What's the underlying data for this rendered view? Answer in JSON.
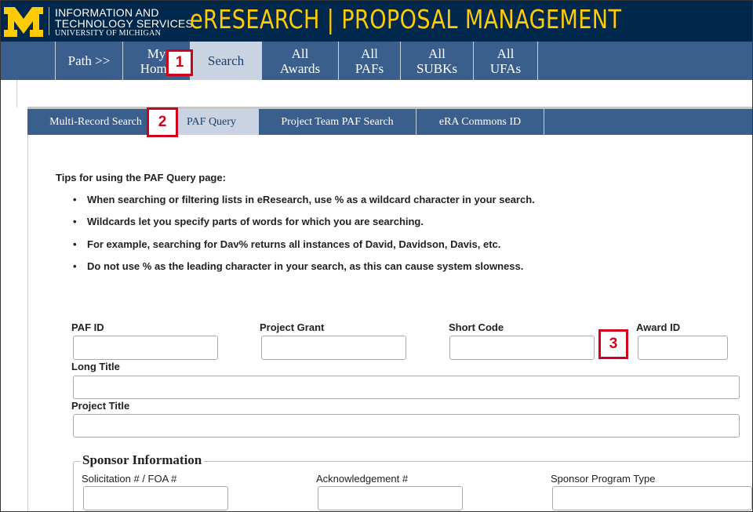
{
  "header": {
    "its_line1": "INFORMATION AND",
    "its_line2": "TECHNOLOGY SERVICES",
    "its_line3": "UNIVERSITY OF MICHIGAN",
    "app_title": "eRESEARCH | PROPOSAL MANAGEMENT",
    "logo_icon": "block-m-logo",
    "brand_colors": {
      "navy": "#00274c",
      "maize": "#ffcb05",
      "nav_blue": "#3a5f8c",
      "active_tab": "#c9d3e1",
      "callout_red": "#d0021b"
    }
  },
  "nav": {
    "path": "Path >>",
    "my_home_1": "My",
    "my_home_2": "Home",
    "search": "Search",
    "all_awards_1": "All",
    "all_awards_2": "Awards",
    "all_pafs_1": "All",
    "all_pafs_2": "PAFs",
    "all_subks_1": "All",
    "all_subks_2": "SUBKs",
    "all_ufas_1": "All",
    "all_ufas_2": "UFAs"
  },
  "subnav": {
    "multi_record": "Multi-Record Search",
    "paf_query": "PAF Query",
    "project_team": "Project Team PAF Search",
    "era_commons": "eRA Commons ID"
  },
  "tips": {
    "title": "Tips for using the PAF Query page:",
    "items": [
      "When searching or filtering lists in eResearch, use % as a wildcard character in your search.",
      "Wildcards let you specify parts of words for which you are searching.",
      "For example, searching for Dav% returns all instances of David, Davidson, Davis, etc.",
      "Do not use % as the leading character in your search, as this can cause system slowness."
    ]
  },
  "form": {
    "paf_id": {
      "label": "PAF ID",
      "value": ""
    },
    "project_grant": {
      "label": "Project Grant",
      "value": ""
    },
    "short_code": {
      "label": "Short Code",
      "value": ""
    },
    "award_id": {
      "label": "Award ID",
      "value": ""
    },
    "long_title": {
      "label": "Long Title",
      "value": ""
    },
    "project_title": {
      "label": "Project Title",
      "value": ""
    }
  },
  "sponsor": {
    "legend": "Sponsor Information",
    "solicitation": {
      "label": "Solicitation # / FOA #",
      "value": ""
    },
    "acknowledgement": {
      "label": "Acknowledgement #",
      "value": ""
    },
    "program_type": {
      "label": "Sponsor Program Type",
      "value": ""
    }
  },
  "callouts": [
    "1",
    "2",
    "3"
  ]
}
